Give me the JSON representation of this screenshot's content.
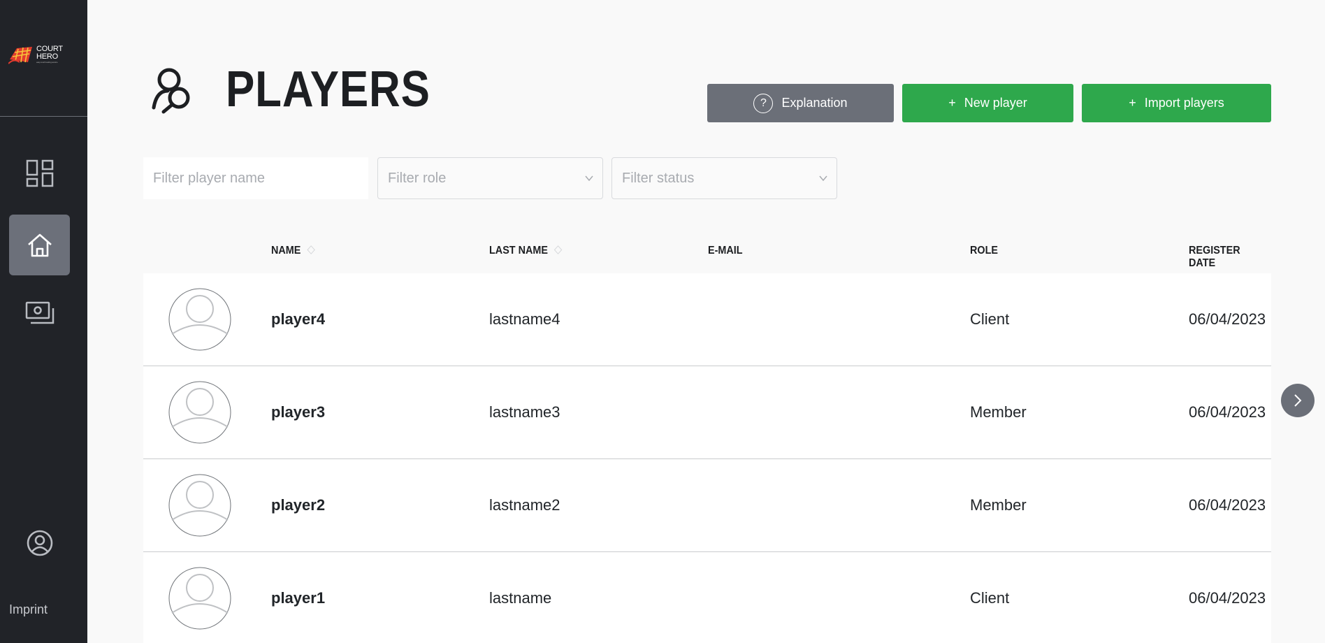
{
  "sidebar": {
    "logo": {
      "line1": "COURT",
      "line2": "HERO",
      "tagline": "easy court booking service"
    },
    "items": [
      {
        "name": "dashboard",
        "icon": "dashboard-icon"
      },
      {
        "name": "home",
        "icon": "home-icon",
        "active": true
      },
      {
        "name": "payments",
        "icon": "money-icon"
      }
    ],
    "profile_icon": "user-circle-icon",
    "imprint_label": "Imprint"
  },
  "header": {
    "title": "PLAYERS",
    "icon": "players-icon"
  },
  "actions": {
    "explanation_icon": "?",
    "explanation_label": "Explanation",
    "new_player_label": "New player",
    "import_players_label": "Import players",
    "plus": "+",
    "colors": {
      "grey": "#6b6f78",
      "green": "#2ea84c"
    }
  },
  "filters": {
    "name_placeholder": "Filter player name",
    "role_placeholder": "Filter role",
    "status_placeholder": "Filter status"
  },
  "table": {
    "columns": {
      "name": "NAME",
      "last_name": "LAST NAME",
      "email": "E-MAIL",
      "role": "ROLE",
      "register_date": "REGISTER DATE"
    },
    "rows": [
      {
        "name": "player4",
        "last_name": "lastname4",
        "email": "",
        "role": "Client",
        "register_date": "06/04/2023"
      },
      {
        "name": "player3",
        "last_name": "lastname3",
        "email": "",
        "role": "Member",
        "register_date": "06/04/2023"
      },
      {
        "name": "player2",
        "last_name": "lastname2",
        "email": "",
        "role": "Member",
        "register_date": "06/04/2023"
      },
      {
        "name": "player1",
        "last_name": "lastname",
        "email": "",
        "role": "Client",
        "register_date": "06/04/2023"
      }
    ]
  },
  "scroll_right_icon": "chevron-right-icon"
}
